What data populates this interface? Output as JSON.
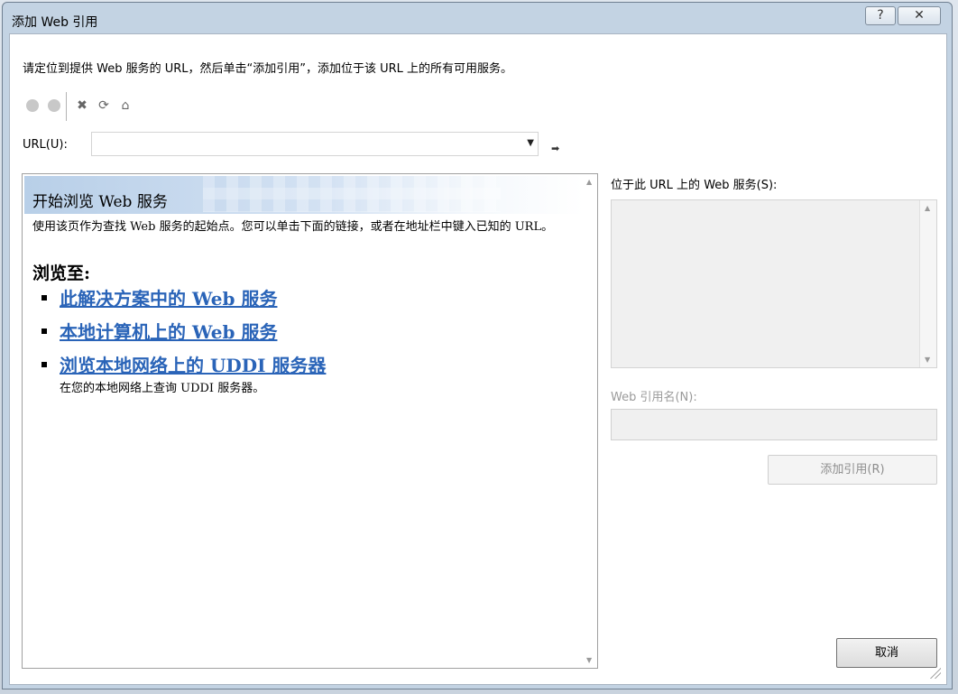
{
  "window": {
    "title": "添加 Web 引用",
    "help_icon": "?",
    "close_icon": "✕"
  },
  "instructions": "请定位到提供 Web 服务的 URL，然后单击“添加引用”，添加位于该 URL 上的所有可用服务。",
  "toolbar": {
    "back_icon": "back-icon",
    "forward_icon": "forward-icon",
    "stop_glyph": "✖",
    "refresh_glyph": "⟳",
    "home_glyph": "⌂"
  },
  "url": {
    "label": "URL(U):",
    "value": "",
    "go_glyph": "➡"
  },
  "browser": {
    "heading": "开始浏览 Web 服务",
    "description": "使用该页作为查找 Web 服务的起始点。您可以单击下面的链接，或者在地址栏中键入已知的 URL。",
    "browse_to": "浏览至:",
    "links": [
      {
        "label": "此解决方案中的 Web 服务",
        "sub": ""
      },
      {
        "label": "本地计算机上的 Web 服务",
        "sub": ""
      },
      {
        "label": "浏览本地网络上的 UDDI 服务器",
        "sub": "在您的本地网络上查询 UDDI 服务器。"
      }
    ]
  },
  "services": {
    "label": "位于此 URL 上的 Web 服务(S):"
  },
  "reference": {
    "label": "Web 引用名(N):",
    "value": ""
  },
  "buttons": {
    "add": "添加引用(R)",
    "cancel": "取消"
  }
}
